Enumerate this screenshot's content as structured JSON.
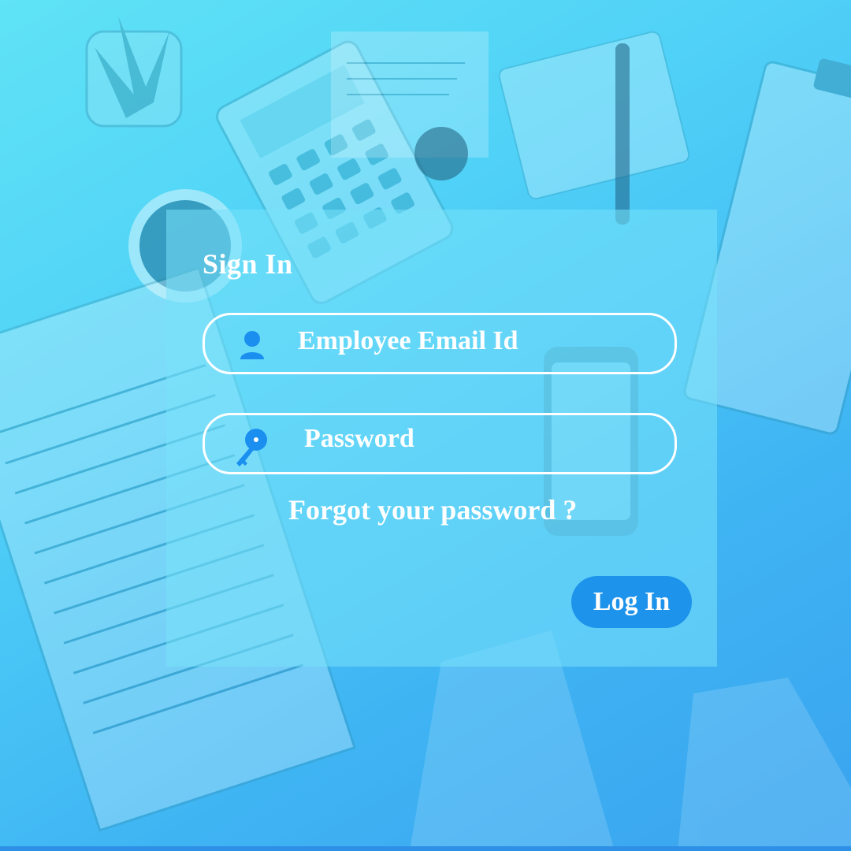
{
  "form": {
    "title": "Sign In",
    "email_placeholder": "Employee Email Id",
    "password_placeholder": "Password",
    "forgot_link": "Forgot your password ?",
    "login_button": "Log In"
  },
  "icons": {
    "email_field": "user-icon",
    "password_field": "key-icon"
  },
  "colors": {
    "accent": "#1d93eb",
    "icon": "#1a8ff0",
    "text": "#ffffff",
    "background_top": "#5fe3f6",
    "background_bottom": "#3aa3ef"
  }
}
